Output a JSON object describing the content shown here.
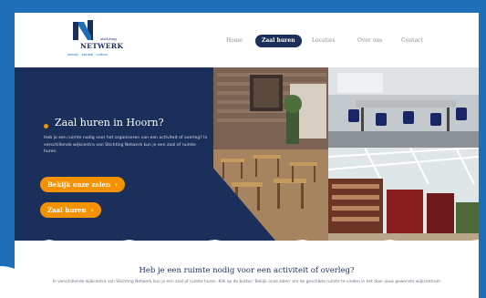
{
  "brand": {
    "small": "stichting",
    "name": "NETWERK",
    "tagline": "welzijn · sociaal · cultuur",
    "navy": "#1a2f5a",
    "accent": "#f39200",
    "blue": "#1e6fb8"
  },
  "nav": {
    "items": [
      {
        "label": "Home",
        "active": false
      },
      {
        "label": "Zaal huren",
        "active": true
      },
      {
        "label": "Locaties",
        "active": false
      },
      {
        "label": "Over ons",
        "active": false
      },
      {
        "label": "Contact",
        "active": false
      }
    ]
  },
  "hero": {
    "title": "Zaal huren in Hoorn?",
    "text": "Heb je een ruimte nodig voor het organiseren van een activiteit of overleg? In verschillende wijkcentra van Stichting Netwerk kun je een zaal of ruimte huren.",
    "buttons": [
      {
        "label": "Bekijk onze zalen",
        "icon": "chevron-right-icon"
      },
      {
        "label": "Zaal huren",
        "icon": "chevron-right-icon"
      }
    ]
  },
  "section": {
    "title": "Heb je een ruimte nodig voor een activiteit of overleg?",
    "text": "In verschillende wijkcentra van Stichting Netwerk kun je een zaal of ruimte huren. Klik op de button 'Bekijk onze zalen' om de geschikte ruimte te vinden in het door jouw gewenste wijkcentrum."
  }
}
